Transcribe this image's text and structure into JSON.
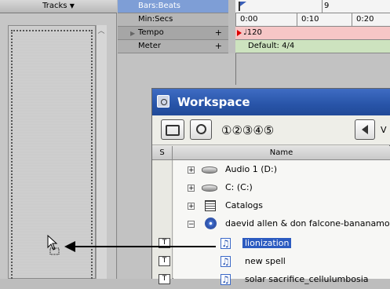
{
  "tracks": {
    "header_label": "Tracks",
    "dropdown_glyph": "▼",
    "scroll_up_glyph": "︿"
  },
  "rulers": {
    "bars_beats": "Bars:Beats",
    "min_secs": "Min:Secs",
    "tempo": "Tempo",
    "meter": "Meter",
    "tempo_expand_glyph": "▶",
    "plus": "+"
  },
  "timeline": {
    "bar_9": "9",
    "time_0": "0:00",
    "time_10": "0:10",
    "time_20": "0:20",
    "tempo_value": "♩120",
    "meter_value": "Default: 4/4"
  },
  "workspace": {
    "title": "Workspace",
    "circled_numbers": "①②③④⑤",
    "toolbar_v": "V",
    "columns": {
      "s": "S",
      "name": "Name"
    },
    "rows": [
      {
        "expander": "+",
        "icon": "drive-icon",
        "label": "Audio 1 (D:)"
      },
      {
        "expander": "+",
        "icon": "drive-icon",
        "label": "C: (C:)"
      },
      {
        "expander": "+",
        "icon": "catalog-icon",
        "label": "Catalogs"
      },
      {
        "expander": "−",
        "icon": "cd-icon",
        "label": "daevid allen & don falcone-bananamo"
      },
      {
        "icon": "audio-file-icon",
        "label": "lionization",
        "selected": true,
        "s": "T"
      },
      {
        "icon": "audio-file-icon",
        "label": "new spell",
        "s": "T"
      },
      {
        "icon": "audio-file-icon",
        "label": "solar sacrifice_cellulumbosia",
        "s": "T"
      }
    ]
  }
}
